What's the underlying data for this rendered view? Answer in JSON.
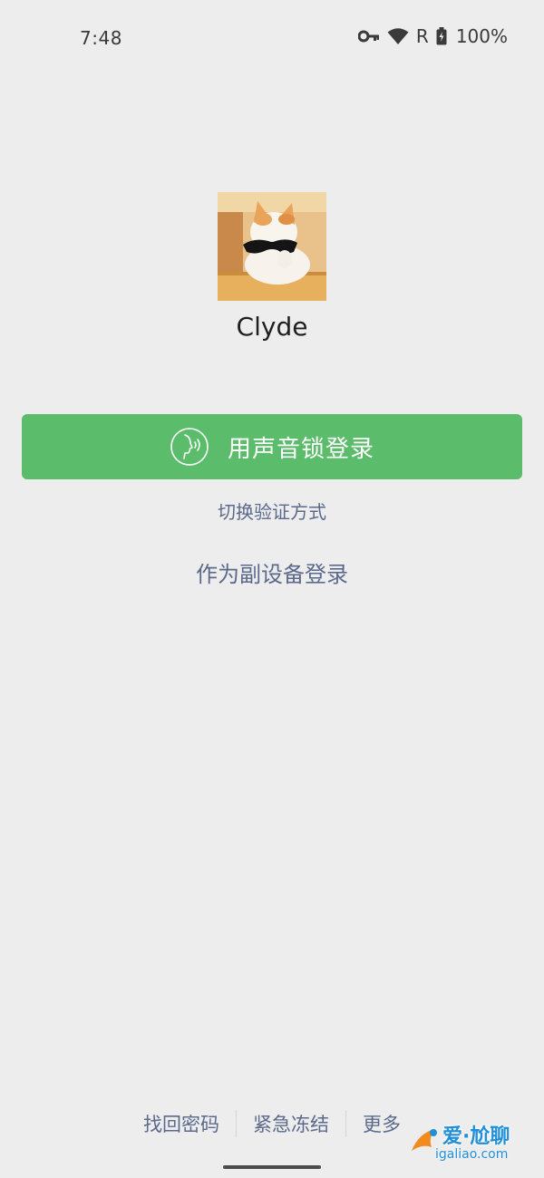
{
  "status_bar": {
    "time": "7:48",
    "icons": [
      "vpn-key-icon",
      "wifi-icon",
      "roaming-r-indicator",
      "battery-icon"
    ],
    "roaming": "R",
    "battery": "100%"
  },
  "profile": {
    "avatar": "cat-with-sunglasses-avatar",
    "name": "Clyde"
  },
  "login": {
    "voice_lock_label": "用声音锁登录",
    "voice_icon": "voice-print-icon",
    "switch_verify_label": "切换验证方式",
    "sub_device_label": "作为副设备登录"
  },
  "bottom_links": {
    "recover_password": "找回密码",
    "emergency_freeze": "紧急冻结",
    "more": "更多"
  },
  "watermark": {
    "line1": "爱·尬聊",
    "line2": "igaliao.com"
  },
  "colors": {
    "background": "#ededed",
    "primary_green": "#5bbd6b",
    "link_blue_gray": "#5b6a8c"
  }
}
